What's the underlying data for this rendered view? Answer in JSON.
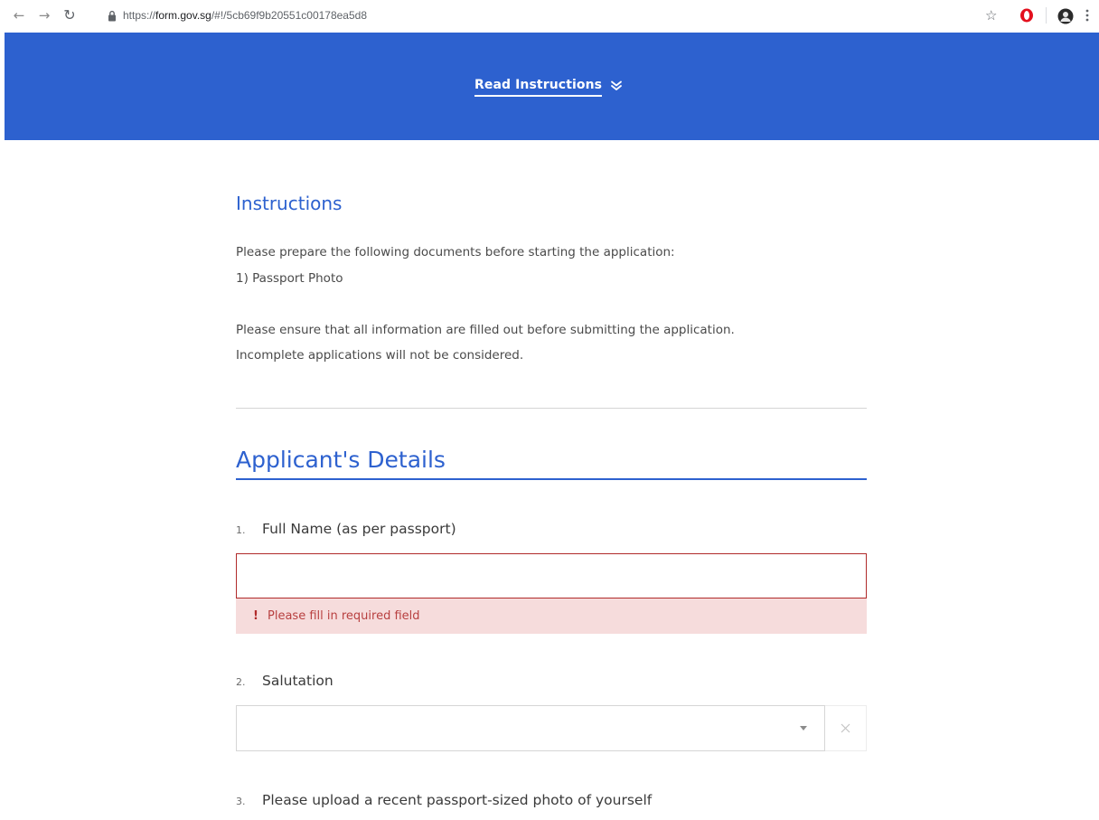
{
  "browser": {
    "url_prefix": "https://",
    "url_host": "form.gov.sg",
    "url_path": "/#!/5cb69f9b20551c00178ea5d8"
  },
  "banner": {
    "read_instructions_label": "Read Instructions",
    "background_color": "#2d61cf"
  },
  "instructions": {
    "title": "Instructions",
    "lines": [
      "Please prepare the following documents before starting the application:",
      "1) Passport Photo",
      "Please ensure that all information are filled out before submitting the application.",
      "Incomplete applications will not be considered."
    ]
  },
  "section": {
    "title": "Applicant's Details"
  },
  "questions": [
    {
      "number": "1.",
      "label": "Full Name (as per passport)",
      "value": "",
      "error_icon": "!",
      "error": "Please fill in required field"
    },
    {
      "number": "2.",
      "label": "Salutation",
      "selected": ""
    },
    {
      "number": "3.",
      "label": "Please upload a recent passport-sized photo of yourself"
    }
  ],
  "colors": {
    "accent": "#2d61cf",
    "error_border": "#b02a2a",
    "error_background": "#f6dcdc"
  },
  "icons": {
    "back": "arrow-left-icon",
    "forward": "arrow-right-icon",
    "reload": "reload-icon",
    "lock": "lock-icon",
    "star": "star-icon",
    "opera": "opera-icon",
    "profile": "profile-icon",
    "menu": "kebab-menu-icon",
    "expand": "double-chevron-down-icon",
    "dropdown": "dropdown-arrow-icon",
    "clear": "close-icon"
  }
}
